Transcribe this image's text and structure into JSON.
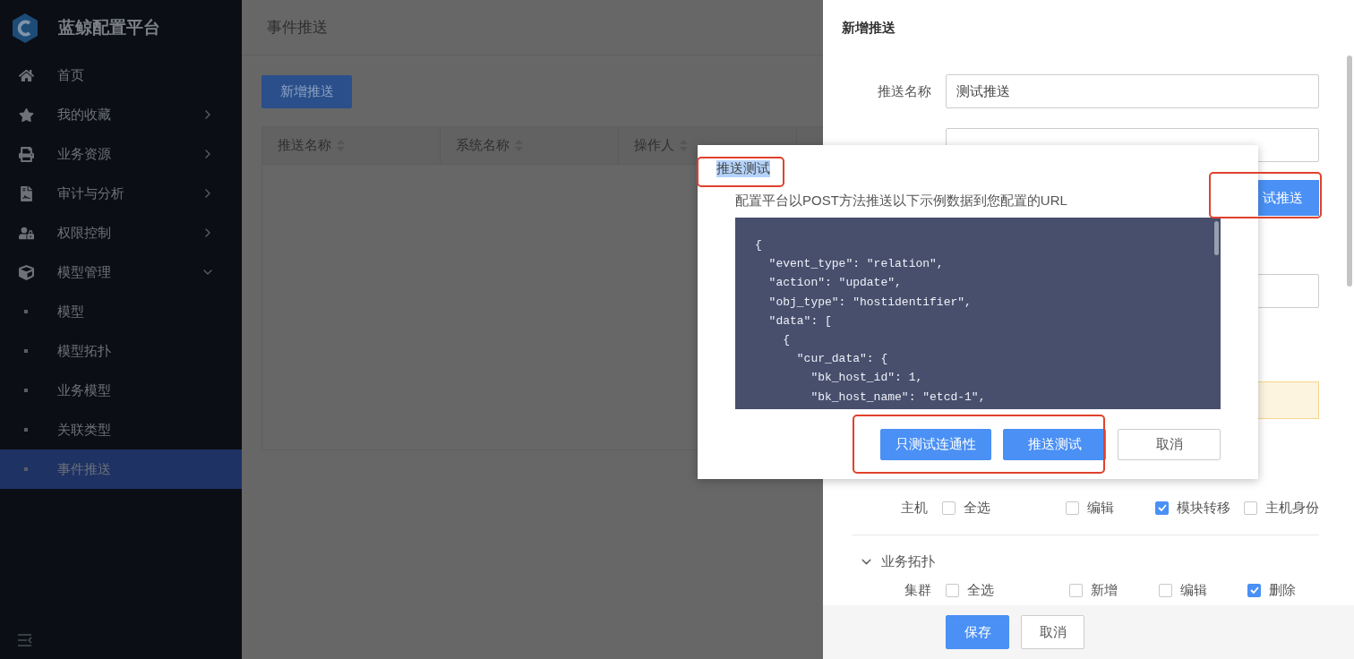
{
  "sidebar": {
    "title": "蓝鲸配置平台",
    "items": [
      {
        "label": "首页",
        "selected": false
      },
      {
        "label": "我的收藏",
        "expanded": false,
        "selected": false
      },
      {
        "label": "业务资源",
        "expanded": false,
        "selected": false
      },
      {
        "label": "审计与分析",
        "expanded": false,
        "selected": false
      },
      {
        "label": "权限控制",
        "expanded": false,
        "selected": false
      },
      {
        "label": "模型管理",
        "expanded": true,
        "selected": false,
        "children": [
          {
            "label": "模型",
            "selected": false
          },
          {
            "label": "模型拓扑",
            "selected": false
          },
          {
            "label": "业务模型",
            "selected": false
          },
          {
            "label": "关联类型",
            "selected": false
          },
          {
            "label": "事件推送",
            "selected": true
          }
        ]
      }
    ]
  },
  "page": {
    "title": "事件推送",
    "add_button": "新增推送",
    "table": {
      "columns": [
        "推送名称",
        "系统名称",
        "操作人"
      ]
    }
  },
  "drawer": {
    "title": "新增推送",
    "name_field": {
      "label": "推送名称",
      "value": "测试推送"
    },
    "test_button": "试推送",
    "permission_rows": [
      {
        "label": "主机",
        "options": [
          {
            "label": "全选",
            "checked": false
          },
          {
            "label": "编辑",
            "checked": false
          },
          {
            "label": "模块转移",
            "checked": true
          },
          {
            "label": "主机身份",
            "checked": false
          }
        ]
      }
    ],
    "sections": [
      {
        "title": "业务拓扑",
        "expanded": true,
        "rows": [
          {
            "label": "集群",
            "options": [
              {
                "label": "全选",
                "checked": false
              },
              {
                "label": "新增",
                "checked": false
              },
              {
                "label": "编辑",
                "checked": false
              },
              {
                "label": "删除",
                "checked": true
              }
            ]
          }
        ]
      }
    ],
    "buttons": [
      {
        "label": "保存",
        "kind": "primary"
      },
      {
        "label": "取消",
        "kind": "default"
      }
    ]
  },
  "dialog": {
    "title": "推送测试",
    "description": "配置平台以POST方法推送以下示例数据到您配置的URL",
    "code": [
      "{",
      "  \"event_type\": \"relation\",",
      "  \"action\": \"update\",",
      "  \"obj_type\": \"hostidentifier\",",
      "  \"data\": [",
      "    {",
      "      \"cur_data\": {",
      "        \"bk_host_id\": 1,",
      "        \"bk_host_name\": \"etcd-1\","
    ],
    "buttons": [
      {
        "label": "只测试连通性",
        "kind": "primary"
      },
      {
        "label": "推送测试",
        "kind": "primary"
      },
      {
        "label": "取消",
        "kind": "default"
      }
    ]
  }
}
